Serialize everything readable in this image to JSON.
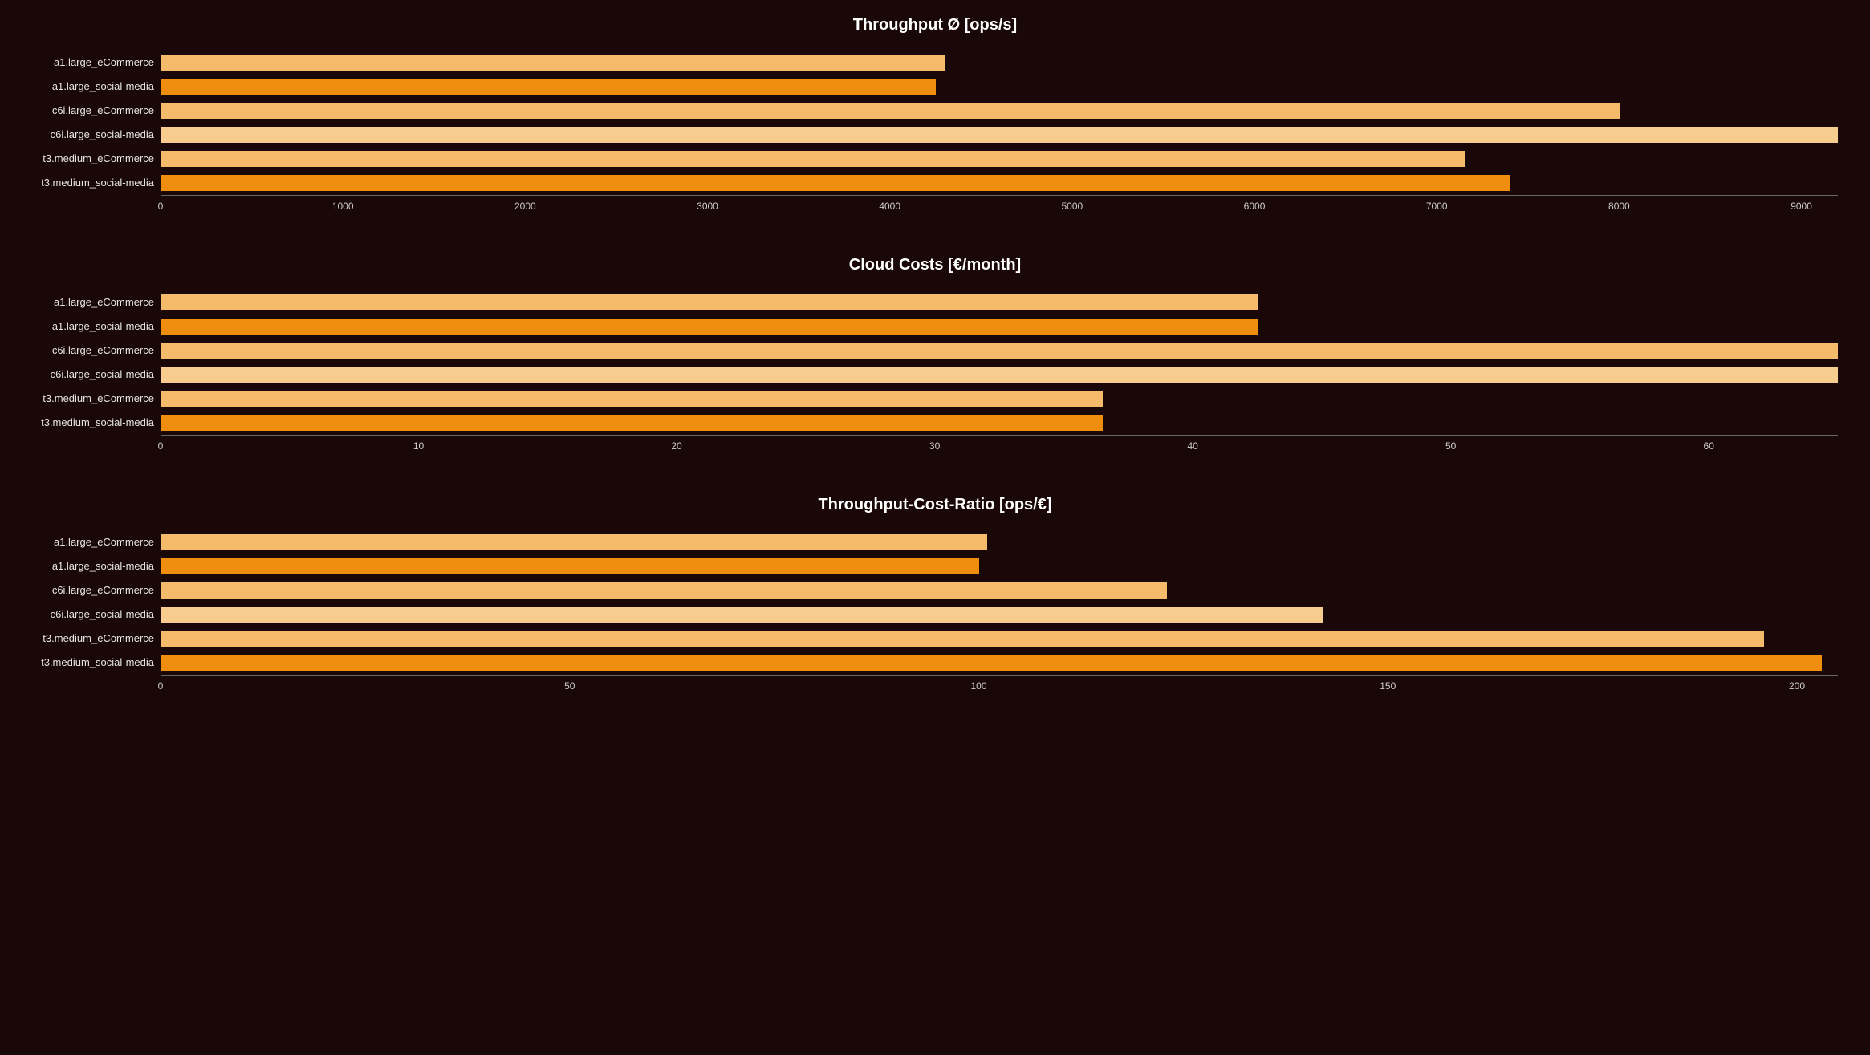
{
  "chart_data": [
    {
      "type": "bar",
      "orientation": "horizontal",
      "title": "Throughput Ø [ops/s]",
      "categories": [
        "a1.large_eCommerce",
        "a1.large_social-media",
        "c6i.large_eCommerce",
        "c6i.large_social-media",
        "t3.medium_eCommerce",
        "t3.medium_social-media"
      ],
      "values": [
        4300,
        4250,
        8000,
        9200,
        7150,
        7400
      ],
      "colors": [
        "#f4bb6a",
        "#ef8e0e",
        "#f4bb6a",
        "#f7cd8f",
        "#f4bb6a",
        "#ef8e0e"
      ],
      "xlim": [
        0,
        9200
      ],
      "x_ticks": [
        0,
        1000,
        2000,
        3000,
        4000,
        5000,
        6000,
        7000,
        8000,
        9000
      ],
      "xlabel": "",
      "ylabel": ""
    },
    {
      "type": "bar",
      "orientation": "horizontal",
      "title": "Cloud Costs [€/month]",
      "categories": [
        "a1.large_eCommerce",
        "a1.large_social-media",
        "c6i.large_eCommerce",
        "c6i.large_social-media",
        "t3.medium_eCommerce",
        "t3.medium_social-media"
      ],
      "values": [
        42.5,
        42.5,
        65,
        65,
        36.5,
        36.5
      ],
      "colors": [
        "#f4bb6a",
        "#ef8e0e",
        "#f4bb6a",
        "#f7cd8f",
        "#f4bb6a",
        "#ef8e0e"
      ],
      "xlim": [
        0,
        65
      ],
      "x_ticks": [
        0,
        10,
        20,
        30,
        40,
        50,
        60
      ],
      "xlabel": "",
      "ylabel": ""
    },
    {
      "type": "bar",
      "orientation": "horizontal",
      "title": "Throughput-Cost-Ratio [ops/€]",
      "categories": [
        "a1.large_eCommerce",
        "a1.large_social-media",
        "c6i.large_eCommerce",
        "c6i.large_social-media",
        "t3.medium_eCommerce",
        "t3.medium_social-media"
      ],
      "values": [
        101,
        100,
        123,
        142,
        196,
        203
      ],
      "colors": [
        "#f4bb6a",
        "#ef8e0e",
        "#f4bb6a",
        "#f7cd8f",
        "#f4bb6a",
        "#ef8e0e"
      ],
      "xlim": [
        0,
        205
      ],
      "x_ticks": [
        0,
        50,
        100,
        150,
        200
      ],
      "xlabel": "",
      "ylabel": ""
    }
  ]
}
